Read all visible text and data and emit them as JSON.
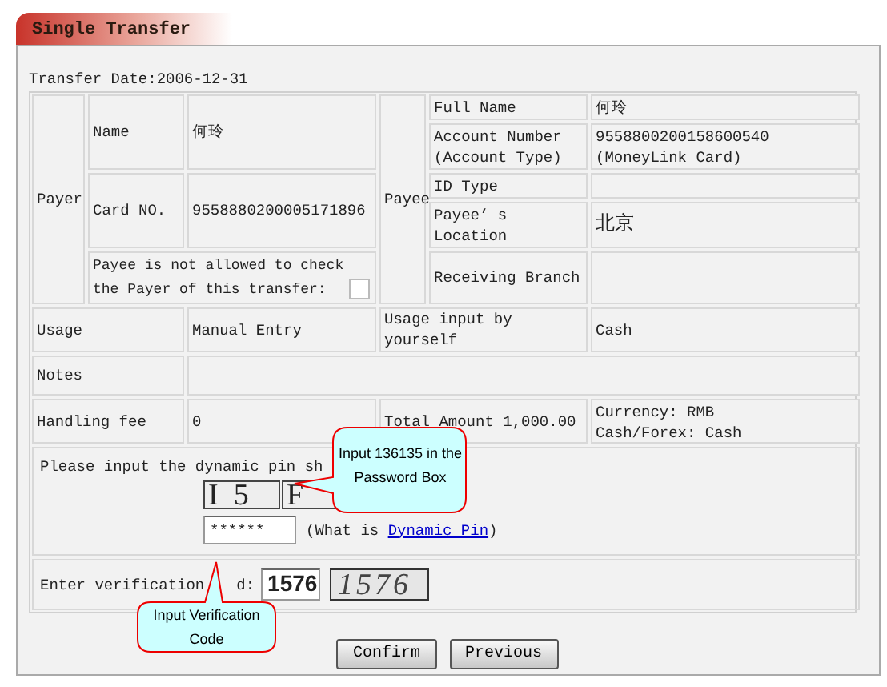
{
  "title": "Single Transfer",
  "transfer_date": "Transfer Date:2006-12-31",
  "payer": {
    "label": "Payer",
    "fields": [
      {
        "label": "Name",
        "value": "何玲"
      },
      {
        "label": "Card NO.",
        "value": "9558880200005171896"
      }
    ],
    "notice": "Payee is not allowed to check the Payer of this transfer:",
    "notice_checked": false
  },
  "payee": {
    "label": "Payee",
    "fields": [
      {
        "label": "Full Name",
        "value": "何玲"
      },
      {
        "label": "Account Number (Account Type)",
        "value": "9558800200158600540 (MoneyLink Card)"
      },
      {
        "label": "ID Type"
      },
      {
        "label": "Payee’ s Location",
        "value": "北京"
      },
      {
        "label": "Receiving Branch"
      }
    ]
  },
  "usage": [
    {
      "label": "Usage",
      "value": "Manual Entry"
    },
    {
      "label": "Usage input by yourself",
      "value": "Cash"
    }
  ],
  "notes": {
    "label": "Notes"
  },
  "fees": [
    {
      "label": "Handling fee",
      "value": "0"
    },
    {
      "label": "Total Amount 1,000.00",
      "value_lines": [
        "Currency: RMB",
        "Cash/Forex: Cash"
      ]
    }
  ],
  "pin": {
    "prompt": "Please input the dynamic pin sh",
    "challenge": [
      "I  5",
      "F"
    ],
    "password": "******",
    "help_before": "(What is ",
    "help_link": "Dynamic Pin",
    "help_after": ")"
  },
  "verification": {
    "label": "Enter verification",
    "label_end": "d:",
    "value": "1576",
    "captcha": "1576"
  },
  "callouts": [
    {
      "text": "Input 136135 in the Password Box"
    },
    {
      "text": "Input Verification Code"
    }
  ],
  "buttons": [
    "Confirm",
    "Previous"
  ]
}
